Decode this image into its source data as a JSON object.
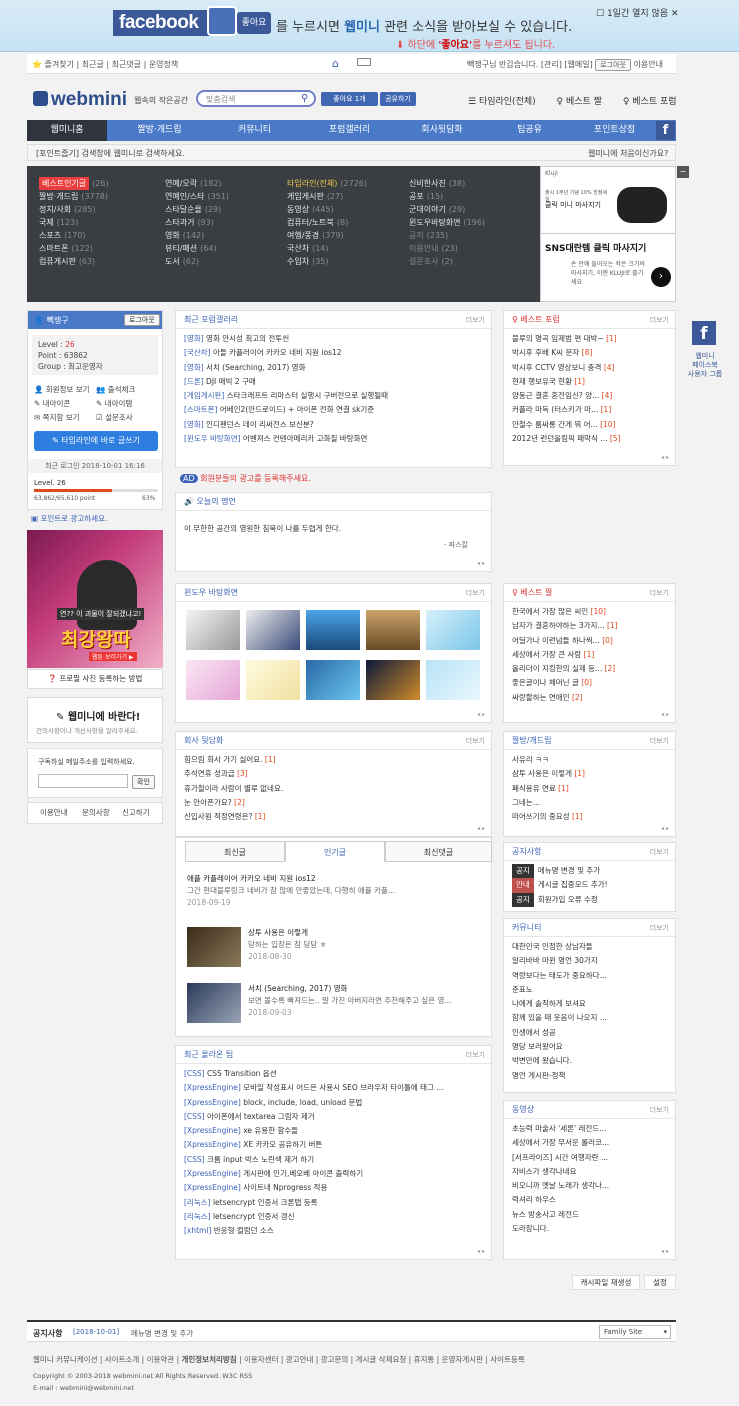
{
  "fb_banner": {
    "logo": "facebook",
    "like": "좋아요",
    "text_pre": "를 누르시면 ",
    "brand": "웹미니",
    "text_post": " 관련 소식을 받아보실 수 있습니다.",
    "sub_pre": "하단에 ",
    "sub_bold": "'좋아요'",
    "sub_post": "를 누르셔도 됩니다.",
    "close_text": "1일간 열지 않음"
  },
  "util": {
    "left": "⭐ 즐겨찾기 | 최근글 | 최근댓글 | 운영정책",
    "user": "빽쟁구님 반갑습니다.",
    "links": "[관리] [웹메일]",
    "logout": "로그아웃",
    "about": "이용안내"
  },
  "header": {
    "logo": "webmini",
    "tagline": "웹속의 작은공간",
    "search_placeholder": "맞춤검색",
    "fb_like": "좋아요 1개",
    "fb_share": "공유하기",
    "timeline": "타임라인(전체)",
    "best_pal": "베스트 짤",
    "best_forum": "베스트 포럼"
  },
  "nav": [
    "웹미니홈",
    "짤방·개드립",
    "커뮤니티",
    "포럼갤러리",
    "회사뒷담화",
    "팁공유",
    "포인트상점"
  ],
  "notice_bar": {
    "left": "[포인트줍기] 검색창에 웹미니로 검색하세요.",
    "right": "웹미니에 처음이신가요?"
  },
  "categories": {
    "col1": [
      [
        "베스트인기글",
        "26"
      ],
      [
        "짤방·개드립",
        "3778"
      ],
      [
        "정치/사회",
        "285"
      ],
      [
        "국제",
        "123"
      ],
      [
        "스포츠",
        "170"
      ],
      [
        "스마트폰",
        "122"
      ],
      [
        "컴퓨게시판",
        "63"
      ]
    ],
    "col2": [
      [
        "연예/오락",
        "182"
      ],
      [
        "연예인/스타",
        "351"
      ],
      [
        "스타달순욜",
        "29"
      ],
      [
        "스타과거",
        "93"
      ],
      [
        "영화",
        "142"
      ],
      [
        "뷰티/패션",
        "64"
      ],
      [
        "도서",
        "62"
      ]
    ],
    "col3": [
      [
        "타임라인(전체)",
        "2726"
      ],
      [
        "게임게시판",
        "27"
      ],
      [
        "동영상",
        "445"
      ],
      [
        "컴퓨터/노트북",
        "8"
      ],
      [
        "여행/풍경",
        "379"
      ],
      [
        "국산차",
        "14"
      ],
      [
        "수입차",
        "35"
      ]
    ],
    "col4": [
      [
        "신비한사진",
        "38"
      ],
      [
        "공포",
        "15"
      ],
      [
        "군대이야기",
        "29"
      ],
      [
        "윈도우바탕화면",
        "196"
      ],
      [
        "공지",
        "235"
      ],
      [
        "이용안내",
        "23"
      ],
      [
        "설문조사",
        "2"
      ]
    ]
  },
  "ad_top": {
    "brand": "Kluji",
    "text1": "출시 1주년 기념 10% 한정세일",
    "text2": "클릭 미니 마사지기",
    "text3": "SNS대란템 클릭 마사지기",
    "text4": "손 안에 들어오는 작은 크기의 마사지기, 이젠 KLUJI로 즐기세요"
  },
  "login": {
    "user": "빽쟁구",
    "logout": "로그아웃",
    "level": "26",
    "point": "63862",
    "group": "최고운영자",
    "links": [
      "회원정보 보기",
      "출석체크",
      "내아이콘",
      "내아이템",
      "쪽지함 보기",
      "설문조사"
    ],
    "timeline_btn": "타임라인에 바로 글쓰기",
    "last_login": "최근 로그인 2018-10-01 16:16",
    "level_label": "Level. 26",
    "point_progress": "63,862/65,610 point",
    "percent": "63%",
    "progress": 0.63
  },
  "left_ad": {
    "label": "포인트로 광고하세요.",
    "ad_text1": "연?? 이 괴물이 잘되겠냐고!",
    "ad_text2": "최강왕따",
    "ad_btn": "웹툰 보러가기 ▶",
    "howto": "프로필 사진 등록하는 방법"
  },
  "wish": {
    "title": "웹미니에 바란다!",
    "sub": "건의사항이나 개선사항을 알려주세요."
  },
  "subscribe": {
    "label": "구독하실 메일주소를 입력하세요.",
    "btn": "확인"
  },
  "footlinks": [
    "이용안내",
    "문의사항",
    "신고하기"
  ],
  "forum": {
    "title": "최근 포럼갤러리",
    "more": "더보기",
    "items": [
      [
        "[영화]",
        "영화 안시성 최고의 전투씬"
      ],
      [
        "[국산차]",
        "아들 카플러이어 카카오 네비 지원 ios12"
      ],
      [
        "[영화]",
        "서치 (Searching, 2017) 영화"
      ],
      [
        "[드론]",
        "DJI 매빅 2 구매"
      ],
      [
        "[게임게시판]",
        "스타크래프트 리마스터 실행시 구버전으로 실행될때"
      ],
      [
        "[스마트폰]",
        "어베인2(안드로이드) + 아이폰 전화 연결 sk기준"
      ],
      [
        "[영화]",
        "인디펜던스 데이 리써전스 보신분?"
      ],
      [
        "[윈도우 바탕화면]",
        "어벤져스 컨텐아메리카 고화질 바탕화면"
      ]
    ]
  },
  "ad_notice": "회원분들의 광고를 등록해주세요.",
  "quote": {
    "title": "오늘의 명언",
    "text": "이 무한한 공간의 영원한 침묵이 나를 두렵게 한다.",
    "author": "- 파스칼"
  },
  "best_forum": {
    "title": "베스트 포럼",
    "more": "더보기",
    "items": [
      [
        "블루의 명곡 임제범 편 대박~",
        "1"
      ],
      [
        "박시후 후배 K씨 문자",
        "8"
      ],
      [
        "박시후 CCTV 영상보니 충격",
        "4"
      ],
      [
        "현재 행보유국 현황",
        "1"
      ],
      [
        "양동근 결혼 혼전임신? 양...",
        "4"
      ],
      [
        "커플라 마득 (터스키가 마...",
        "1"
      ],
      [
        "안철수 룸싸롱 간게 뭐 어...",
        "10"
      ],
      [
        "2012년 런던올림픽 패막식 ...",
        "5"
      ]
    ]
  },
  "wallpaper": {
    "title": "윈도우 바탕화면",
    "more": "더보기"
  },
  "best_pal": {
    "title": "베스트 짤",
    "more": "더보기",
    "items": [
      [
        "한국에서 가장 많은 씨인",
        "10"
      ],
      [
        "남자가 결혼하야하는 3가지...",
        "1"
      ],
      [
        "어딜가나 이런넘들 하나씩...",
        "0"
      ],
      [
        "세상에서 가장 큰 사람",
        "1"
      ],
      [
        "올리더이 지킹한의 실제 등...",
        "2"
      ],
      [
        "좋은글이나 체머닌 글",
        "0"
      ],
      [
        "싸랑할하는 연애인",
        "2"
      ]
    ]
  },
  "company": {
    "title": "회사 뒷담화",
    "more": "더보기",
    "items": [
      [
        "힘으림 회사 가기 싫어요.",
        "1"
      ],
      [
        "추석연휴 성과급",
        "3"
      ],
      [
        "휴가철이라 사람이 별루 없네요.",
        ""
      ],
      [
        "눈 안아픈가요?",
        "2"
      ],
      [
        "신입사원 적정연령은?",
        "1"
      ]
    ]
  },
  "pal_gaedrip": {
    "title": "짤방/개드립",
    "more": "더보기",
    "items": [
      [
        "사유리 ㅋㅋ",
        ""
      ],
      [
        "삼투 사용은 이렇게",
        "1"
      ],
      [
        "폐식용유 연료",
        "1"
      ],
      [
        "그네는...",
        ""
      ],
      [
        "떠어쓰기의 중요성",
        "1"
      ]
    ]
  },
  "tabs": [
    "최신글",
    "인기글",
    "최신댓글"
  ],
  "popular": [
    {
      "title": "애플 카플레이어 카카오 네비 지원 ios12",
      "desc": "그간 현대블루링크 네비가 참 많에 안좋았는데, 다행히 애플 카플...",
      "date": "2018-09-19"
    },
    {
      "title": "상투 사용은 이렇게",
      "desc": "당하는 입장은 참 당당 ㅎ",
      "date": "2018-08-30"
    },
    {
      "title": "서치 (Searching, 2017) 영화",
      "desc": "보면 볼수록 빠져드는.. 말 가진 아버지라면 추천해주고 싶은 영...",
      "date": "2018-09-03"
    }
  ],
  "notice": {
    "title": "공지사항",
    "more": "더보기",
    "items": [
      [
        "공지",
        "메뉴명 변경 및 추가"
      ],
      [
        "안내",
        "게시글 집중모드 추가!"
      ],
      [
        "공지",
        "회원가입 오류 수정"
      ]
    ]
  },
  "community": {
    "title": "커뮤니티",
    "more": "더보기",
    "items": [
      "대한민국 인정한 상남자들",
      "알리바바 마윈 명언 30가지",
      "역량보다는 태도가 중요하다...",
      "춘표노",
      "나에게 솔직하게 보셔요",
      "함께 있을 때 웃음이 나오지 ...",
      "인생에서 성공",
      "명당 보러왔어요",
      "박변만에 왔습니다.",
      "명언 게시판-정책"
    ]
  },
  "tips": {
    "title": "최근 올라온 팁",
    "more": "더보기",
    "items": [
      [
        "[CSS]",
        "CSS Transition 옵션"
      ],
      [
        "[XpressEngine]",
        "모바일 작성표시 어드은 사용시 SEO 브라우저 타이틀에 태그 ..."
      ],
      [
        "[XpressEngine]",
        "block, include, load, unload 문법"
      ],
      [
        "[CSS]",
        "아이폰에서 textarea 그림자 제거"
      ],
      [
        "[XpressEngine]",
        "xe 유용한 함수들"
      ],
      [
        "[XpressEngine]",
        "XE 카카오 공유하기 버튼"
      ],
      [
        "[CSS]",
        "크롬 input 박스 노란색 제거 하기"
      ],
      [
        "[XpressEngine]",
        "게시판에 인기,베오베 아이콘 출력하기"
      ],
      [
        "[XpressEngine]",
        "사이트내 Nprogress 적용"
      ],
      [
        "[리눅스]",
        "letsencrypt 인증서 크론탭 등록"
      ],
      [
        "[리눅스]",
        "letsencrypt 인증서 갱신"
      ],
      [
        "[xhtml]",
        "반응형 컬럼던 소스"
      ]
    ]
  },
  "video": {
    "title": "동영상",
    "more": "더보기",
    "items": [
      "초능력 마술사 '세론' 레전드...",
      "세상에서 가장 무서운 롤러코...",
      "[서프라이즈] 시간 여행자란 ...",
      "자비스가 생각나네요",
      "비오니까 옛날 노래가 생각나...",
      "력셔리 하우스",
      "뉴스 방송사고 레전드",
      "도라장니다."
    ]
  },
  "side_fb": {
    "label1": "웹미니",
    "label2": "페이스북",
    "label3": "사용자 그룹"
  },
  "bottom_btns": [
    "캐시파일 재생성",
    "설정"
  ],
  "footer": {
    "notice_title": "공지사항",
    "notice_date": "[2018-10-01]",
    "notice_text": "메뉴명 변경 및 추가",
    "family": "Family Site",
    "links": [
      "웹미니 커뮤니케이션",
      "사이트소개",
      "이용약관",
      "개인정보처리방침",
      "이용자센터",
      "광고안내",
      "광고문의",
      "게시글 삭제요청",
      "휴지통",
      "운영자게시판",
      "사이트등록"
    ],
    "copyright": "Copyright © 2003-2018 webmini.net All Rights Reserved. W3C RSS",
    "email": "E-mail : webmini@webmini.net"
  }
}
